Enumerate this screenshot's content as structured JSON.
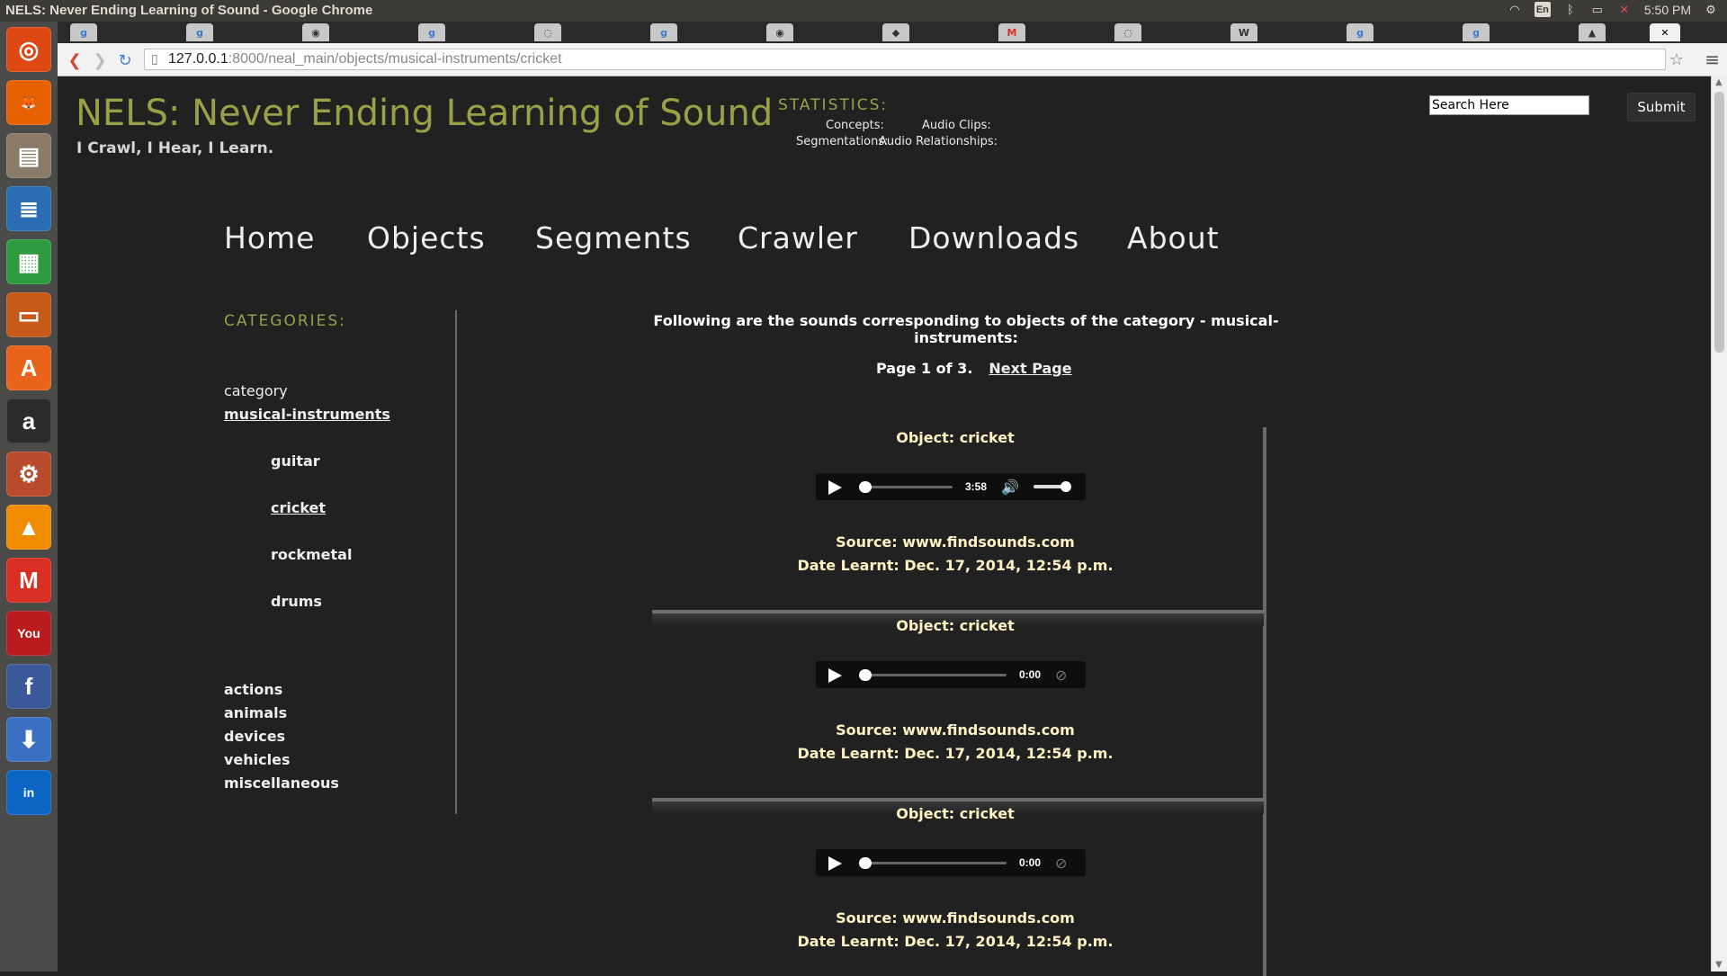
{
  "window": {
    "title": "NELS: Never Ending Learning of Sound - Google Chrome"
  },
  "system_tray": {
    "keyboard": "En",
    "time": "5:50 PM"
  },
  "launcher": {
    "apps": [
      {
        "name": "ubuntu-dash-icon",
        "glyph": "◎",
        "color": "#dd4814"
      },
      {
        "name": "firefox-icon",
        "glyph": "🦊",
        "color": "#e66000"
      },
      {
        "name": "files-icon",
        "glyph": "▤",
        "color": "#8a7a68"
      },
      {
        "name": "writer-icon",
        "glyph": "≣",
        "color": "#2a6db5"
      },
      {
        "name": "calc-icon",
        "glyph": "▦",
        "color": "#2e9b41"
      },
      {
        "name": "impress-icon",
        "glyph": "▭",
        "color": "#c65a1a"
      },
      {
        "name": "software-center-icon",
        "glyph": "A",
        "color": "#e8641b"
      },
      {
        "name": "amazon-icon",
        "glyph": "a",
        "color": "#2b2b2b"
      },
      {
        "name": "system-settings-icon",
        "glyph": "⚙",
        "color": "#b84b2b"
      },
      {
        "name": "vlc-icon",
        "glyph": "▲",
        "color": "#f08c00"
      },
      {
        "name": "gmail-icon",
        "glyph": "M",
        "color": "#d93025"
      },
      {
        "name": "youtube-icon",
        "glyph": "You",
        "color": "#b81c1c"
      },
      {
        "name": "facebook-icon",
        "glyph": "f",
        "color": "#3b5998"
      },
      {
        "name": "downloader-icon",
        "glyph": "⬇",
        "color": "#3a6fc2"
      },
      {
        "name": "linkedin-icon",
        "glyph": "in",
        "color": "#0a66c2"
      }
    ]
  },
  "tabs": {
    "favicons": [
      "g",
      "g",
      "◉",
      "g",
      "◌",
      "g",
      "◉",
      "◆",
      "M",
      "◌",
      "W",
      "g",
      "g",
      "▲"
    ]
  },
  "address_bar": {
    "host": "127.0.0.1",
    "path": ":8000/neal_main/objects/musical-instruments/cricket"
  },
  "header": {
    "site_title": "NELS: Never Ending Learning of Sound",
    "tagline": "I Crawl, I Hear, I Learn.",
    "stats_heading": "STATISTICS:",
    "stats": {
      "concepts": "Concepts:",
      "audio_clips": "Audio Clips:",
      "segmentations": "Segmentations:",
      "audio_relationships": "Audio Relationships:"
    },
    "search_value": "Search Here",
    "submit_label": "Submit"
  },
  "nav": [
    "Home",
    "Objects",
    "Segments",
    "Crawler",
    "Downloads",
    "About"
  ],
  "sidebar": {
    "heading": "CATEGORIES:",
    "group_label": "category",
    "selected_category": "musical-instruments",
    "subitems": [
      "guitar",
      "cricket",
      "rockmetal",
      "drums"
    ],
    "other_categories": [
      "actions",
      "animals",
      "devices",
      "vehicles",
      "miscellaneous"
    ]
  },
  "main": {
    "intro": "Following are the sounds corresponding to objects of the category - musical-instruments:",
    "pager_text": "Page 1 of 3.",
    "next_label": "Next Page",
    "entries": [
      {
        "object": "Object: cricket",
        "time": "3:58",
        "source": "Source: www.findsounds.com",
        "date": "Date Learnt: Dec. 17, 2014, 12:54 p.m."
      },
      {
        "object": "Object: cricket",
        "time": "0:00",
        "source": "Source: www.findsounds.com",
        "date": "Date Learnt: Dec. 17, 2014, 12:54 p.m."
      },
      {
        "object": "Object: cricket",
        "time": "0:00",
        "source": "Source: www.findsounds.com",
        "date": "Date Learnt: Dec. 17, 2014, 12:54 p.m."
      }
    ]
  }
}
